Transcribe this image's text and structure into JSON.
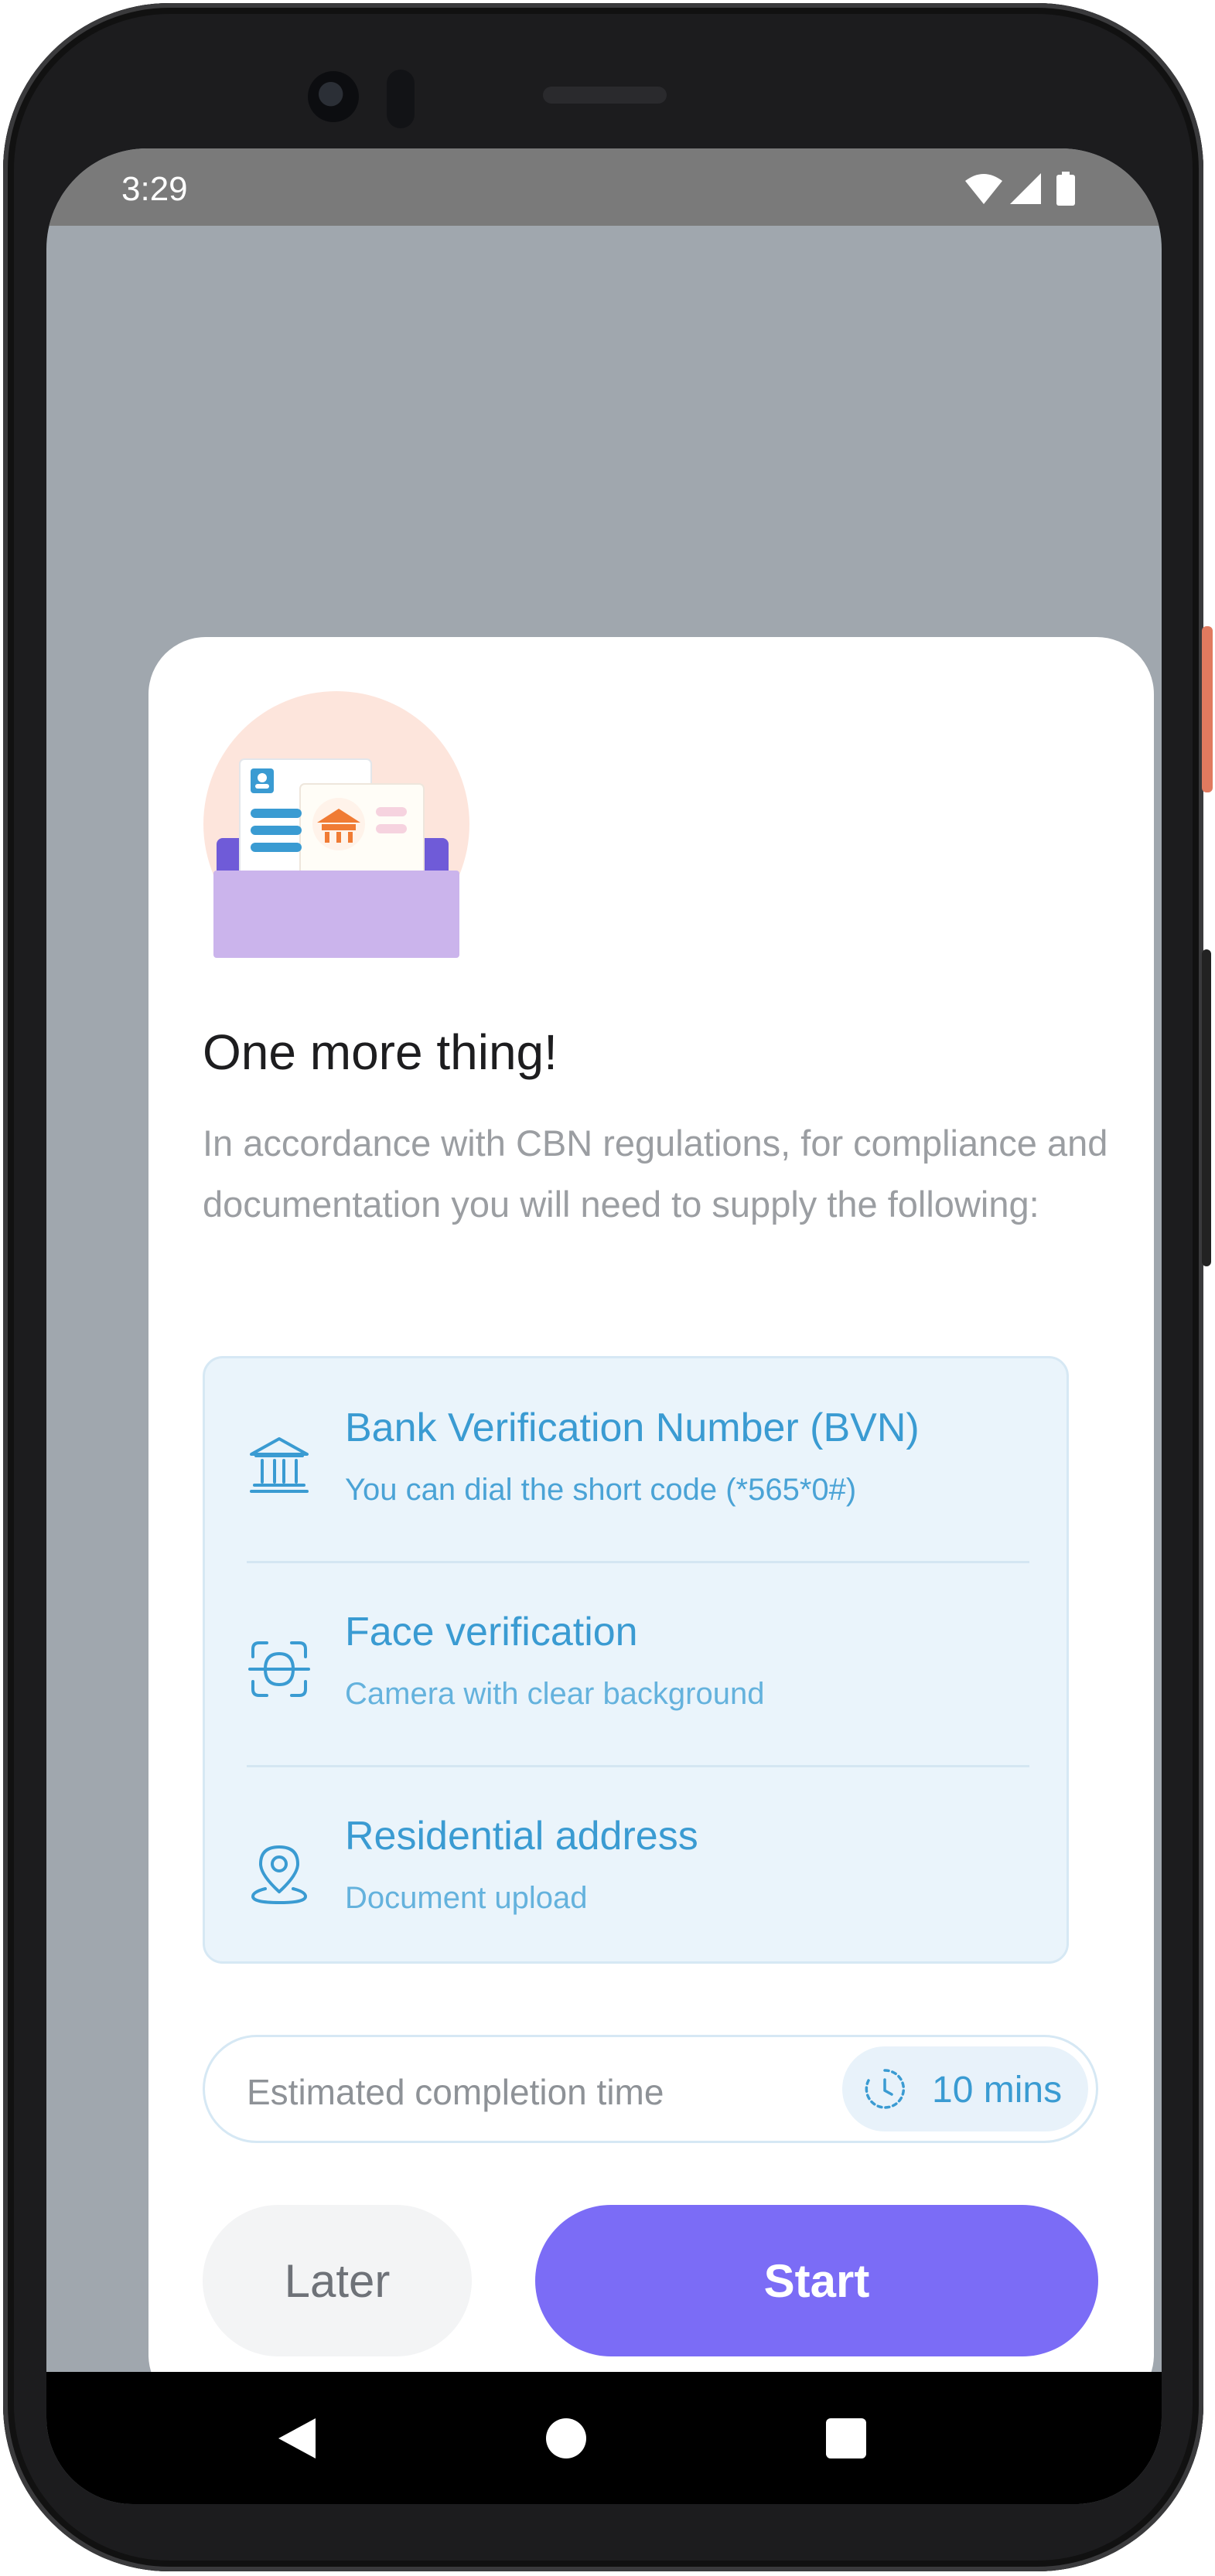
{
  "status_bar": {
    "time": "3:29",
    "icons": [
      "wifi-icon",
      "signal-icon",
      "battery-icon"
    ]
  },
  "sheet": {
    "illustration": "documents-folder-illustration",
    "title": "One more thing!",
    "subtitle": "In accordance with CBN regulations, for compliance and documentation you will need to supply the following:",
    "requirements": [
      {
        "icon": "bank-icon",
        "title": "Bank Verification Number (BVN)",
        "subtitle": "You can dial the short code (*565*0#)"
      },
      {
        "icon": "face-scan-icon",
        "title": "Face verification",
        "subtitle": "Camera with clear background"
      },
      {
        "icon": "location-pin-icon",
        "title": "Residential address",
        "subtitle": "Document upload"
      }
    ],
    "estimate": {
      "label": "Estimated completion time",
      "value": "10 mins",
      "icon": "clock-icon"
    },
    "buttons": {
      "later": "Later",
      "start": "Start"
    }
  },
  "nav_bar": {
    "buttons": [
      "back-icon",
      "home-icon",
      "recents-icon"
    ]
  },
  "colors": {
    "accent": "#7b6cf6",
    "info_blue": "#3a9bd2",
    "info_bg": "#eaf4fb",
    "scrim": "#a0a7ae"
  }
}
